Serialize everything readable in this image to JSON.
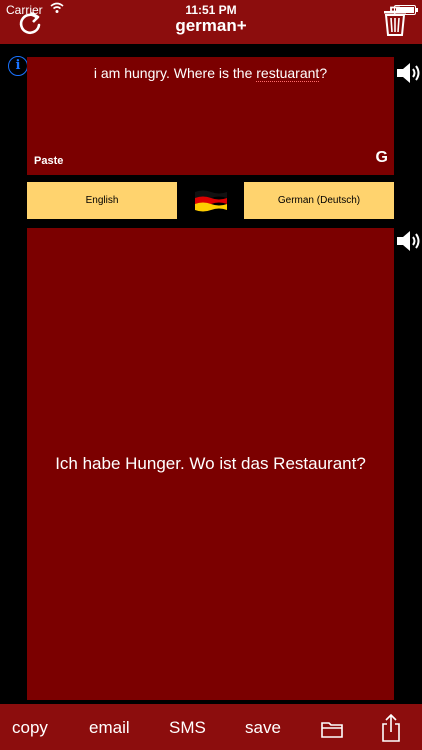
{
  "status_bar": {
    "carrier": "Carrier",
    "time": "11:51 PM",
    "wifi_icon": "wifi-icon",
    "battery_icon": "battery-icon"
  },
  "nav_bar": {
    "title": "german+",
    "left_icon": "refresh-icon",
    "right_icon": "trash-icon"
  },
  "input": {
    "text_before": "i am hungry. Where is the ",
    "text_misspelled": "restuarant",
    "text_after": "?",
    "paste_label": "Paste",
    "google_label": "G"
  },
  "languages": {
    "source": "English",
    "target": "German (Deutsch)",
    "flag_icon": "german-flag-icon"
  },
  "output": {
    "text": "Ich habe Hunger. Wo ist das Restaurant?"
  },
  "toolbar": {
    "copy": "copy",
    "email": "email",
    "sms": "SMS",
    "save": "save",
    "folder_icon": "folder-icon",
    "share_icon": "share-icon"
  },
  "colors": {
    "bar": "#8c0d0d",
    "panel": "#7b0000",
    "language_button": "#ffd36e",
    "info": "#1a73ff"
  }
}
